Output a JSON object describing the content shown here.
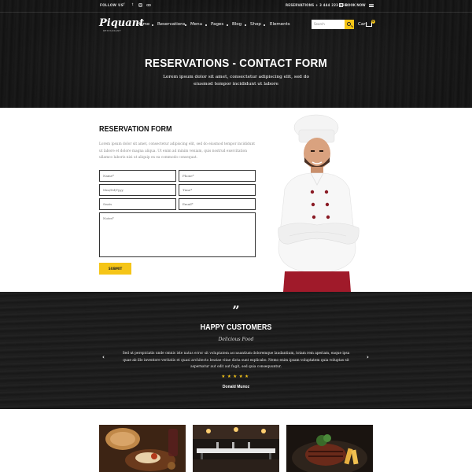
{
  "topbar": {
    "follow": "FOLLOW US",
    "social_icons": [
      "facebook-icon",
      "twitter-icon",
      "instagram-icon",
      "tripadvisor-icon"
    ],
    "reservations": "RESERVATIONS + 3 444 223 458",
    "book_now": "BOOK NOW"
  },
  "header": {
    "logo": "Piquant",
    "logo_tag": "RESTAURANT",
    "nav": [
      "Home",
      "Reservations",
      "Menu",
      "Pages",
      "Blog",
      "Shop",
      "Elements"
    ],
    "search_placeholder": "Search",
    "cart_label": "Cart",
    "cart_count": "0"
  },
  "hero": {
    "title": "RESERVATIONS - CONTACT FORM",
    "subtitle": "Lorem ipsum dolor sit amet, consectetur adipiscing elit, sed do eiusmod tempor incididunt ut labore"
  },
  "form": {
    "title": "RESERVATION FORM",
    "text": "Lorem ipsum dolor sit amet, consectetur adipiscing elit, sed do eiusmod tempor incididunt ut labore et dolore magna aliqua. Ut enim ad minim veniam, quis nostrud exercitation ullamco laboris nisi ut aliquip ex ea commodo consequat.",
    "name": "Name*",
    "phone": "Phone*",
    "date": "Mm/Dd/Yyyy",
    "time": "Time*",
    "seats": "Seats",
    "email": "Email*",
    "notes": "Notes*",
    "submit": "SUBMIT"
  },
  "testimonials": {
    "quote_mark": "”",
    "title": "HAPPY CUSTOMERS",
    "subtitle": "Delicious Food",
    "text": "Sed ut perspiciatis unde omnis iste natus error sit voluptatem accusantium doloremque laudantium, totam rem aperiam, eaque ipsa quae ab illo inventore veritatis et quasi architecto beatae vitae dicta sunt explicabo. Nemo enim ipsam voluptatem quia voluptas sit aspernatur aut odit aut fugit, sed quia consequuntur.",
    "rating": 5,
    "stars": "★★★★★",
    "author": "Donald Munoz",
    "prev_arrow": "‹",
    "next_arrow": "›"
  },
  "colors": {
    "accent": "#f5c518",
    "dark": "#161616",
    "chef_pants": "#a01a2a"
  }
}
